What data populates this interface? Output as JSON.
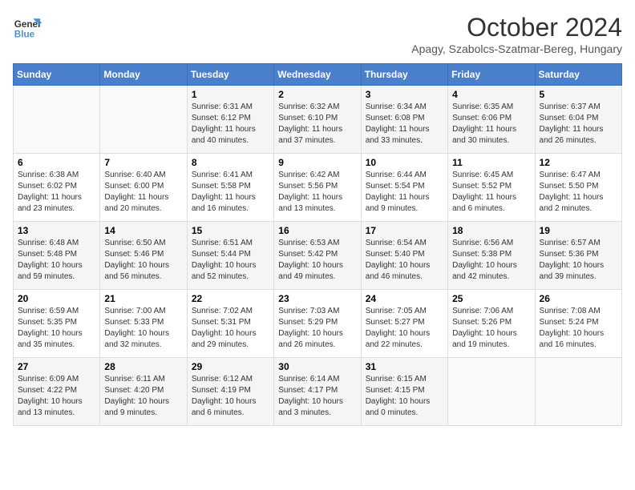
{
  "header": {
    "logo_line1": "General",
    "logo_line2": "Blue",
    "month_title": "October 2024",
    "subtitle": "Apagy, Szabolcs-Szatmar-Bereg, Hungary"
  },
  "weekdays": [
    "Sunday",
    "Monday",
    "Tuesday",
    "Wednesday",
    "Thursday",
    "Friday",
    "Saturday"
  ],
  "weeks": [
    [
      {
        "day": "",
        "info": ""
      },
      {
        "day": "",
        "info": ""
      },
      {
        "day": "1",
        "info": "Sunrise: 6:31 AM\nSunset: 6:12 PM\nDaylight: 11 hours and 40 minutes."
      },
      {
        "day": "2",
        "info": "Sunrise: 6:32 AM\nSunset: 6:10 PM\nDaylight: 11 hours and 37 minutes."
      },
      {
        "day": "3",
        "info": "Sunrise: 6:34 AM\nSunset: 6:08 PM\nDaylight: 11 hours and 33 minutes."
      },
      {
        "day": "4",
        "info": "Sunrise: 6:35 AM\nSunset: 6:06 PM\nDaylight: 11 hours and 30 minutes."
      },
      {
        "day": "5",
        "info": "Sunrise: 6:37 AM\nSunset: 6:04 PM\nDaylight: 11 hours and 26 minutes."
      }
    ],
    [
      {
        "day": "6",
        "info": "Sunrise: 6:38 AM\nSunset: 6:02 PM\nDaylight: 11 hours and 23 minutes."
      },
      {
        "day": "7",
        "info": "Sunrise: 6:40 AM\nSunset: 6:00 PM\nDaylight: 11 hours and 20 minutes."
      },
      {
        "day": "8",
        "info": "Sunrise: 6:41 AM\nSunset: 5:58 PM\nDaylight: 11 hours and 16 minutes."
      },
      {
        "day": "9",
        "info": "Sunrise: 6:42 AM\nSunset: 5:56 PM\nDaylight: 11 hours and 13 minutes."
      },
      {
        "day": "10",
        "info": "Sunrise: 6:44 AM\nSunset: 5:54 PM\nDaylight: 11 hours and 9 minutes."
      },
      {
        "day": "11",
        "info": "Sunrise: 6:45 AM\nSunset: 5:52 PM\nDaylight: 11 hours and 6 minutes."
      },
      {
        "day": "12",
        "info": "Sunrise: 6:47 AM\nSunset: 5:50 PM\nDaylight: 11 hours and 2 minutes."
      }
    ],
    [
      {
        "day": "13",
        "info": "Sunrise: 6:48 AM\nSunset: 5:48 PM\nDaylight: 10 hours and 59 minutes."
      },
      {
        "day": "14",
        "info": "Sunrise: 6:50 AM\nSunset: 5:46 PM\nDaylight: 10 hours and 56 minutes."
      },
      {
        "day": "15",
        "info": "Sunrise: 6:51 AM\nSunset: 5:44 PM\nDaylight: 10 hours and 52 minutes."
      },
      {
        "day": "16",
        "info": "Sunrise: 6:53 AM\nSunset: 5:42 PM\nDaylight: 10 hours and 49 minutes."
      },
      {
        "day": "17",
        "info": "Sunrise: 6:54 AM\nSunset: 5:40 PM\nDaylight: 10 hours and 46 minutes."
      },
      {
        "day": "18",
        "info": "Sunrise: 6:56 AM\nSunset: 5:38 PM\nDaylight: 10 hours and 42 minutes."
      },
      {
        "day": "19",
        "info": "Sunrise: 6:57 AM\nSunset: 5:36 PM\nDaylight: 10 hours and 39 minutes."
      }
    ],
    [
      {
        "day": "20",
        "info": "Sunrise: 6:59 AM\nSunset: 5:35 PM\nDaylight: 10 hours and 35 minutes."
      },
      {
        "day": "21",
        "info": "Sunrise: 7:00 AM\nSunset: 5:33 PM\nDaylight: 10 hours and 32 minutes."
      },
      {
        "day": "22",
        "info": "Sunrise: 7:02 AM\nSunset: 5:31 PM\nDaylight: 10 hours and 29 minutes."
      },
      {
        "day": "23",
        "info": "Sunrise: 7:03 AM\nSunset: 5:29 PM\nDaylight: 10 hours and 26 minutes."
      },
      {
        "day": "24",
        "info": "Sunrise: 7:05 AM\nSunset: 5:27 PM\nDaylight: 10 hours and 22 minutes."
      },
      {
        "day": "25",
        "info": "Sunrise: 7:06 AM\nSunset: 5:26 PM\nDaylight: 10 hours and 19 minutes."
      },
      {
        "day": "26",
        "info": "Sunrise: 7:08 AM\nSunset: 5:24 PM\nDaylight: 10 hours and 16 minutes."
      }
    ],
    [
      {
        "day": "27",
        "info": "Sunrise: 6:09 AM\nSunset: 4:22 PM\nDaylight: 10 hours and 13 minutes."
      },
      {
        "day": "28",
        "info": "Sunrise: 6:11 AM\nSunset: 4:20 PM\nDaylight: 10 hours and 9 minutes."
      },
      {
        "day": "29",
        "info": "Sunrise: 6:12 AM\nSunset: 4:19 PM\nDaylight: 10 hours and 6 minutes."
      },
      {
        "day": "30",
        "info": "Sunrise: 6:14 AM\nSunset: 4:17 PM\nDaylight: 10 hours and 3 minutes."
      },
      {
        "day": "31",
        "info": "Sunrise: 6:15 AM\nSunset: 4:15 PM\nDaylight: 10 hours and 0 minutes."
      },
      {
        "day": "",
        "info": ""
      },
      {
        "day": "",
        "info": ""
      }
    ]
  ]
}
